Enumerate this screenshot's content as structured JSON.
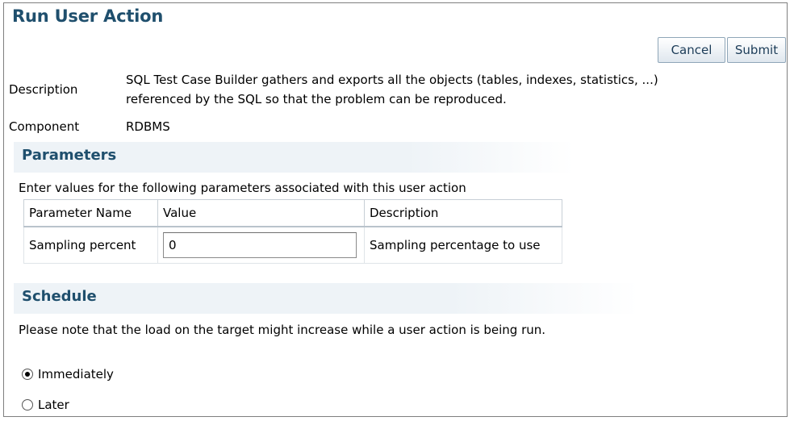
{
  "page": {
    "title": "Run User Action"
  },
  "toolbar": {
    "cancel_label": "Cancel",
    "submit_label": "Submit"
  },
  "details": {
    "description_label": "Description",
    "description_line1": "SQL Test Case Builder gathers and exports all the objects (tables, indexes, statistics, ...)",
    "description_line2": "referenced by the SQL so that the problem can be reproduced.",
    "component_label": "Component",
    "component_value": "RDBMS"
  },
  "parameters": {
    "heading": "Parameters",
    "instructions": "Enter values for the following parameters associated with this user action",
    "columns": [
      "Parameter Name",
      "Value",
      "Description"
    ],
    "rows": [
      {
        "name": "Sampling percent",
        "value": "0",
        "description": "Sampling percentage to use"
      }
    ]
  },
  "schedule": {
    "heading": "Schedule",
    "note": "Please note that the load on the target might increase while a user action is being run.",
    "options": [
      {
        "label": "Immediately",
        "selected": true
      },
      {
        "label": "Later",
        "selected": false
      }
    ]
  }
}
